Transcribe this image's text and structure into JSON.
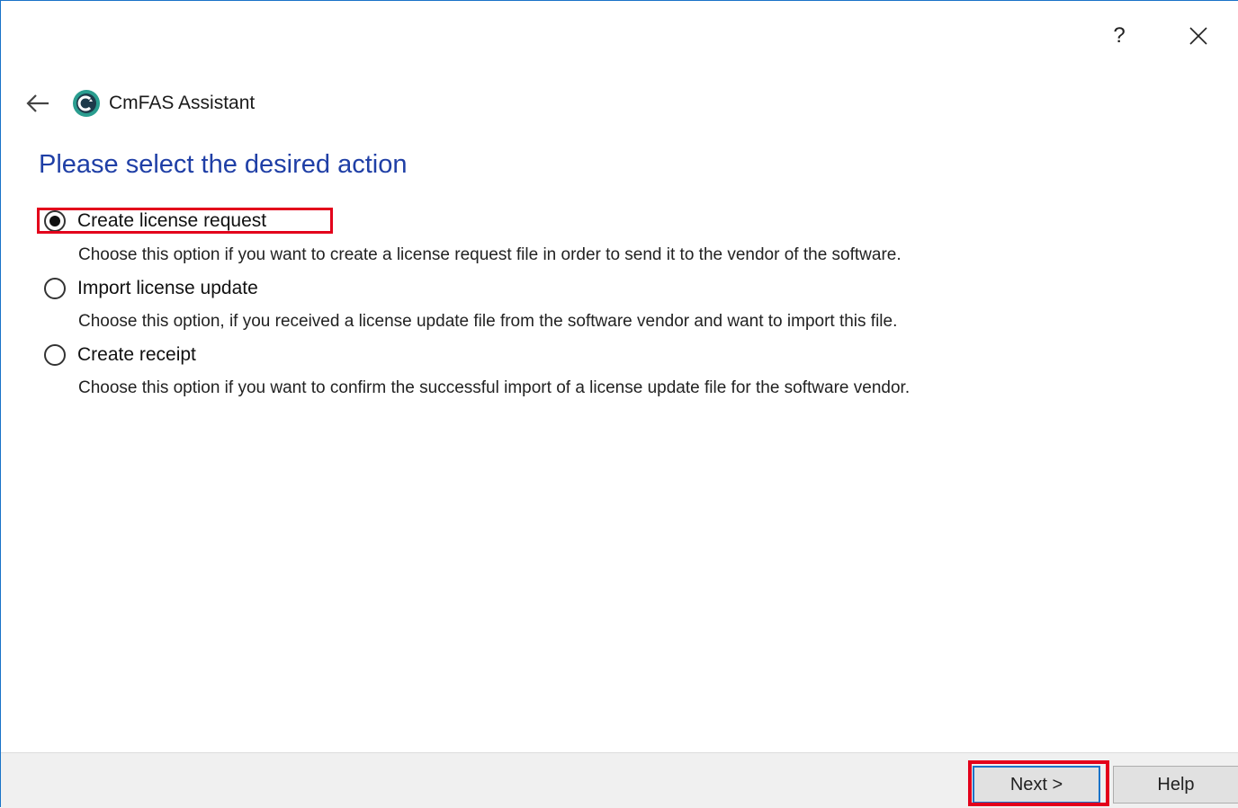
{
  "window": {
    "help_glyph": "?",
    "close_icon": "close-icon"
  },
  "header": {
    "back_icon": "back-arrow-icon",
    "app_icon": "cmfas-logo-icon",
    "app_title": "CmFAS Assistant"
  },
  "page": {
    "title": "Please select the desired action"
  },
  "options": [
    {
      "label": "Create license request",
      "description": "Choose this option if you want to create a license request file in order to send it to the vendor of the software.",
      "selected": true
    },
    {
      "label": "Import license update",
      "description": "Choose this option, if you received a license update file from the software vendor and want to import this file.",
      "selected": false
    },
    {
      "label": "Create receipt",
      "description": "Choose this option if you want to confirm the successful import of a license update file for the software vendor.",
      "selected": false
    }
  ],
  "footer": {
    "next_label": "Next >",
    "help_label": "Help"
  },
  "colors": {
    "accent": "#1a73c8",
    "title": "#1f3fa6",
    "highlight": "#e3001b",
    "logo": "#2a9d8f"
  }
}
